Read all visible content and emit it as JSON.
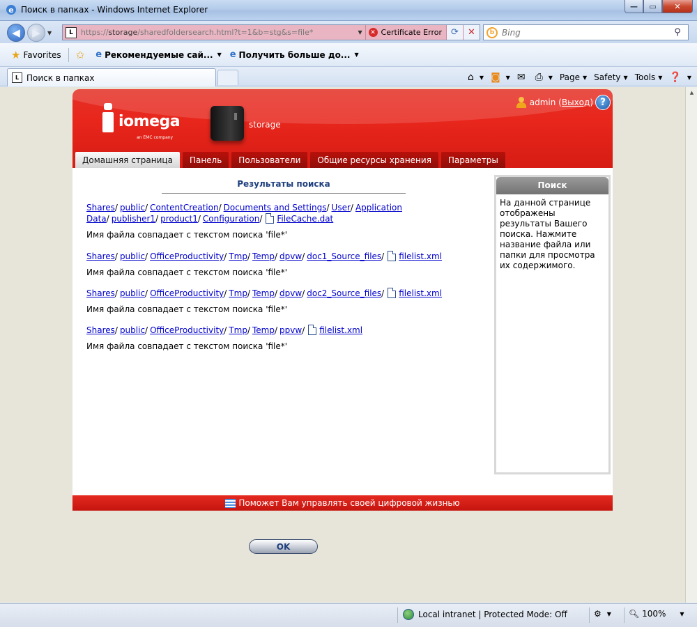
{
  "window": {
    "title": "Поиск в папках - Windows Internet Explorer"
  },
  "address": {
    "url_prefix": "https://",
    "url_host": "storage",
    "url_path": "/sharedfoldersearch.html?t=1&b=stg&s=file*",
    "cert_error": "Certificate Error"
  },
  "search": {
    "placeholder": "Bing"
  },
  "favorites": {
    "label": "Favorites",
    "item1": "Рекомендуемые сай...",
    "item2": "Получить больше до..."
  },
  "tab": {
    "title": "Поиск в папках"
  },
  "commandbar": {
    "page": "Page",
    "safety": "Safety",
    "tools": "Tools"
  },
  "app": {
    "logo_word": "iomega",
    "logo_sub": "an EMC company",
    "device_name": "storage",
    "user": "admin",
    "logout": "Выход",
    "nav": [
      {
        "label": "Домашняя страница"
      },
      {
        "label": "Панель"
      },
      {
        "label": "Пользователи"
      },
      {
        "label": "Общие ресурсы хранения"
      },
      {
        "label": "Параметры"
      }
    ],
    "results_title": "Результаты поиска",
    "match_text": "Имя файла совпадает с текстом поиска 'file*'",
    "results": [
      {
        "path": [
          "Shares",
          "public",
          "ContentCreation",
          "Documents and Settings",
          "User",
          "Application Data",
          "publisher1",
          "product1",
          "Configuration"
        ],
        "file": "FileCache.dat"
      },
      {
        "path": [
          "Shares",
          "public",
          "OfficeProductivity",
          "Tmp",
          "Temp",
          "dpvw",
          "doc1_Source_files"
        ],
        "file": "filelist.xml"
      },
      {
        "path": [
          "Shares",
          "public",
          "OfficeProductivity",
          "Tmp",
          "Temp",
          "dpvw",
          "doc2_Source_files"
        ],
        "file": "filelist.xml"
      },
      {
        "path": [
          "Shares",
          "public",
          "OfficeProductivity",
          "Tmp",
          "Temp",
          "ppvw"
        ],
        "file": "filelist.xml"
      }
    ],
    "ok_label": "OK",
    "sidebar_title": "Поиск",
    "sidebar_text": "На данной странице отображены результаты Вашего поиска. Нажмите название файла или папки для просмотра их содержимого.",
    "footer_text": "Поможет Вам управлять своей цифровой жизнью"
  },
  "status": {
    "zone": "Local intranet | Protected Mode: Off",
    "zoom": "100%"
  }
}
